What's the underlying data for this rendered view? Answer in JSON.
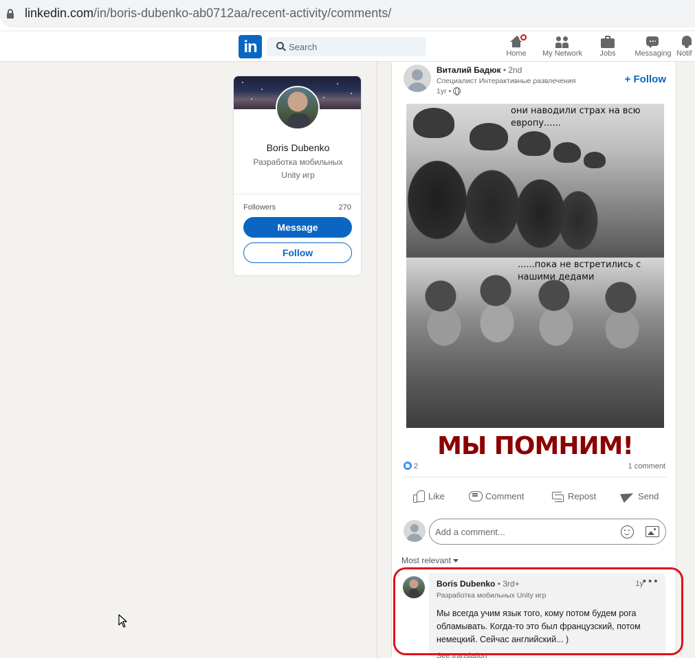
{
  "browser": {
    "url_host": "linkedin.com",
    "url_path": "/in/boris-dubenko-ab0712aa/recent-activity/comments/"
  },
  "nav": {
    "logo_text": "in",
    "search_placeholder": "Search",
    "items": [
      {
        "label": "Home",
        "icon": "home-icon",
        "has_badge": true
      },
      {
        "label": "My Network",
        "icon": "people-icon"
      },
      {
        "label": "Jobs",
        "icon": "briefcase-icon"
      },
      {
        "label": "Messaging",
        "icon": "chat-icon"
      },
      {
        "label": "Notif",
        "icon": "bell-icon"
      }
    ]
  },
  "profile": {
    "name": "Boris Dubenko",
    "headline": "Разработка мобильных Unity игр",
    "followers_label": "Followers",
    "followers_count": "270",
    "message_label": "Message",
    "follow_label": "Follow"
  },
  "post": {
    "author_name": "Виталий Бадюк",
    "author_degree": "• 2nd",
    "author_headline": "Специалист Интерактивные развлечения",
    "time": "1yr •",
    "follow_label": "+ Follow",
    "image": {
      "caption_top": "они наводили страх на всю европу......",
      "caption_mid": "......пока не встретились с нашими дедами",
      "caption_big": "МЫ ПОМНИМ!"
    },
    "reaction_count": "2",
    "comment_count": "1 comment",
    "actions": {
      "like": "Like",
      "comment": "Comment",
      "repost": "Repost",
      "send": "Send"
    },
    "add_comment_placeholder": "Add a comment...",
    "sort_label": "Most relevant"
  },
  "comment": {
    "author_name": "Boris Dubenko",
    "author_degree": "• 3rd+",
    "author_headline": "Разработка мобильных Unity игр",
    "time": "1y",
    "more_label": "•••",
    "text": "Мы всегда учим язык того, кому потом будем рога обламывать. Когда-то это был французский, потом немецкий. Сейчас английский... )",
    "see_translation": "See translation"
  },
  "colors": {
    "brand": "#0a66c2",
    "highlight": "#e0101a",
    "caption_big": "#8b0000"
  }
}
